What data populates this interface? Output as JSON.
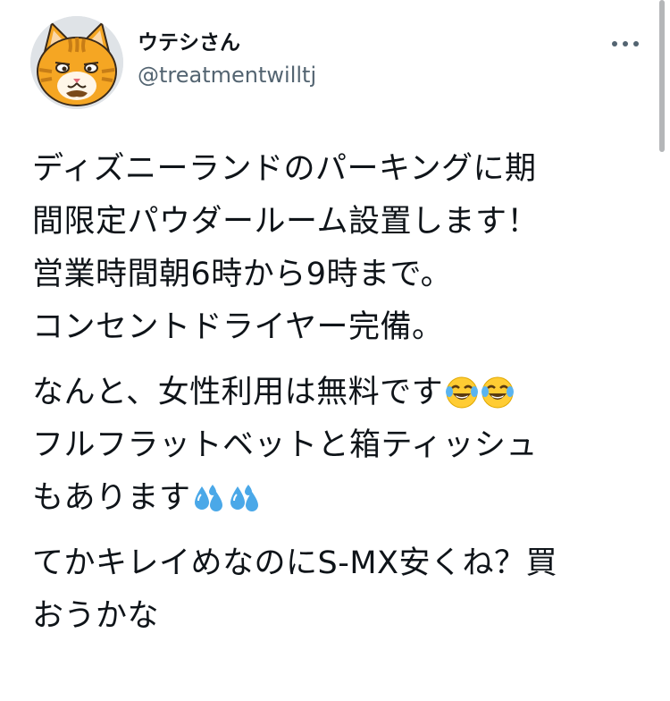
{
  "user": {
    "display_name": "ウテシさん",
    "handle": "@treatmentwilltj",
    "avatar_icon": "cat-avatar-icon"
  },
  "header": {
    "more_icon": "more-options-icon"
  },
  "tweet": {
    "paragraphs": [
      {
        "lines": [
          "ディズニーランドのパーキングに期",
          "間限定パウダールーム設置します！",
          "営業時間朝6時から9時まで。",
          "コンセントドライヤー完備。"
        ]
      },
      {
        "lines": [
          "なんと、女性利用は無料です",
          "フルフラットベットと箱ティッシュ",
          "もあります"
        ],
        "emojis": [
          "face-with-tears-of-joy-emoji",
          "face-with-tears-of-joy-emoji",
          "sweat-droplets-emoji",
          "sweat-droplets-emoji"
        ]
      },
      {
        "lines": [
          "てかキレイめなのにS-MX安くね？買",
          "おうかな"
        ]
      }
    ]
  },
  "colors": {
    "text": "#0f1419",
    "secondary": "#536471",
    "avatar_orange": "#f5a623"
  }
}
